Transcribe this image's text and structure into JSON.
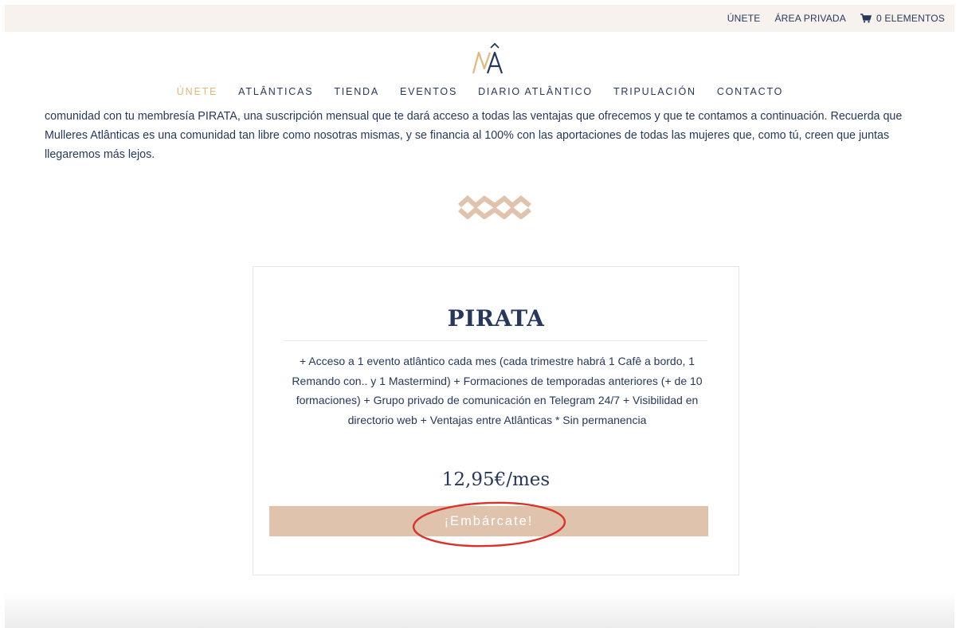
{
  "topbar": {
    "join": "ÚNETE",
    "private_area": "ÁREA PRIVADA",
    "cart": "0 ELEMENTOS"
  },
  "logo": {
    "text": "MÂ"
  },
  "nav": {
    "items": [
      "ÚNETE",
      "ATLÂNTICAS",
      "TIENDA",
      "EVENTOS",
      "DIARIO ATLÂNTICO",
      "TRIPULACIÓN",
      "CONTACTO"
    ],
    "active": "ÚNETE"
  },
  "intro": {
    "text": "comunidad con tu membresía PIRATA, una suscripción mensual que te dará acceso a todas las ventajas que ofrecemos y que te contamos a continuación. Recuerda que Mulleres Atlânticas es una comunidad tan libre como nosotras mismas, y se financia al 100% con las aportaciones de todas las mujeres que, como tú, creen que juntas llegaremos más lejos."
  },
  "plan": {
    "title": "PIRATA",
    "description": "+ Acceso a 1 evento atlântico cada mes (cada trimestre habrá 1 Cafê a bordo, 1 Remando con.. y 1 Mastermind) + Formaciones de temporadas anteriores (+ de 10 formaciones) + Grupo privado de comunicación en Telegram 24/7 + Visibilidad en directorio web + Ventajas entre Atlânticas * Sin permanencia",
    "price": "12,95€/mes",
    "cta": "¡Embárcate!"
  },
  "colors": {
    "navy": "#26385c",
    "gold": "#e2b87a",
    "sand": "#dfc3ad",
    "annotation": "#d9322b"
  },
  "icons": {
    "cart": "cart-icon",
    "divider": "zigzag-divider-icon"
  }
}
